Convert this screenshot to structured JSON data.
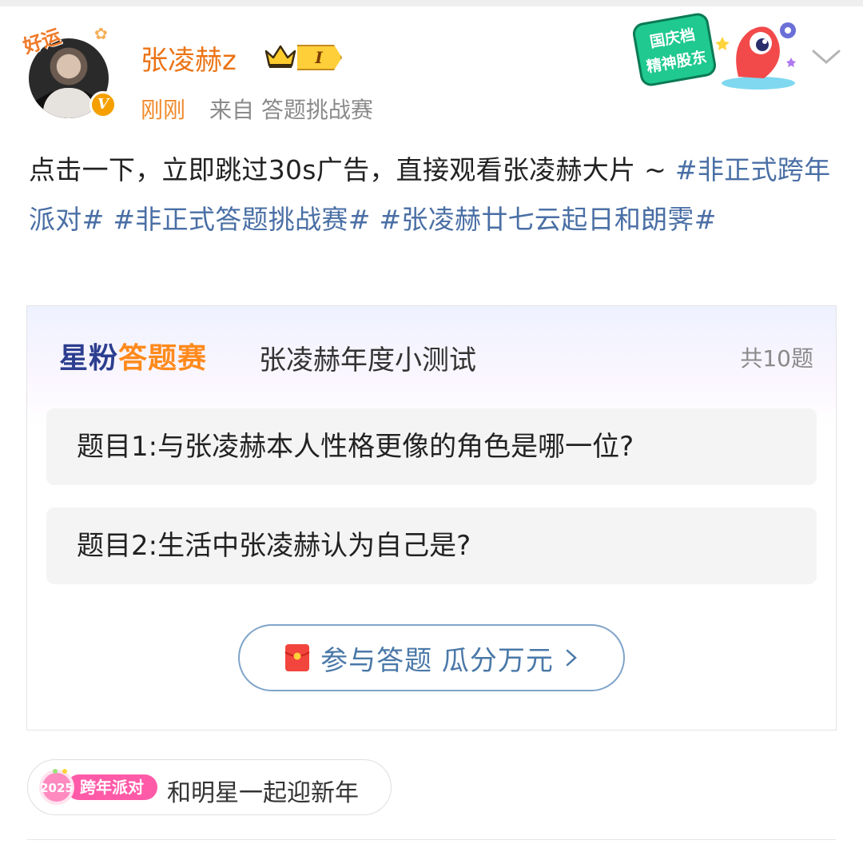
{
  "header": {
    "avatar_deco_text": "好运",
    "username": "张凌赫z",
    "level": "I",
    "time": "刚刚",
    "source": "来自 答题挑战赛",
    "verified_mark": "V"
  },
  "promo": {
    "line1": "国庆档",
    "line2": "精神股东"
  },
  "post": {
    "text": "点击一下，立即跳过30s广告，直接观看张凌赫大片 ~ ",
    "hashtags": [
      "#非正式跨年派对#",
      "#非正式答题挑战赛#",
      "#张凌赫廿七云起日和朗霁#"
    ]
  },
  "quiz": {
    "logo_part1": "星粉",
    "logo_part2": "答题赛",
    "title": "张凌赫年度小测试",
    "count": "共10题",
    "questions": [
      "题目1:与张凌赫本人性格更像的角色是哪一位?",
      "题目2:生活中张凌赫认为自己是?"
    ],
    "join_label": "参与答题 瓜分万元"
  },
  "event": {
    "badge_text": "跨年派对",
    "badge_year": "2025",
    "label": "和明星一起迎新年"
  },
  "colors": {
    "username": "#eb7314",
    "hashtag": "#4a6fa5",
    "join_border": "#7fa4c9",
    "join_text": "#4a78a8"
  }
}
